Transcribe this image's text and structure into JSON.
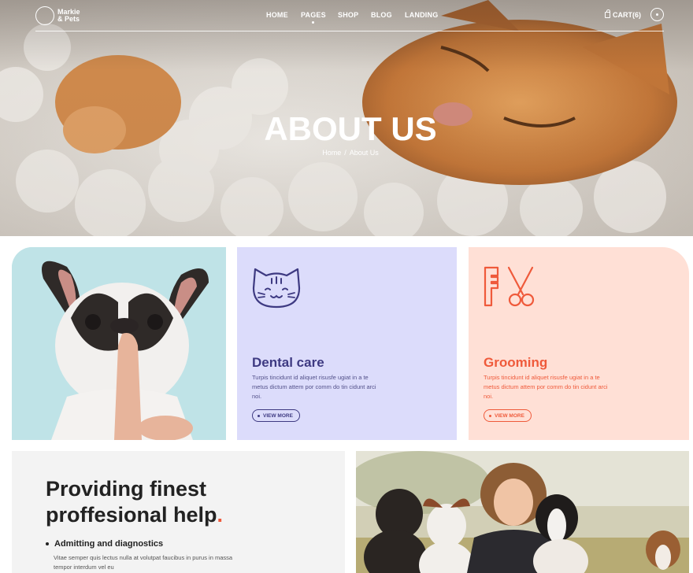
{
  "header": {
    "logo_line1": "Markie",
    "logo_line2": "& Pets",
    "nav": [
      "HOME",
      "PAGES",
      "SHOP",
      "BLOG",
      "LANDING"
    ],
    "active_nav": "PAGES",
    "cart_label": "CART(6)"
  },
  "hero": {
    "title": "ABOUT US",
    "breadcrumb_home": "Home",
    "breadcrumb_sep": "/",
    "breadcrumb_current": "About Us"
  },
  "cards": {
    "dental": {
      "title": "Dental care",
      "text": "Turpis tincidunt id aliquet risusfe ugiat in a te metus dictum attem por comm do tin cidunt arci noi.",
      "button": "VIEW MORE",
      "icon": "cat-icon",
      "color": "#3e3a82",
      "bg": "#dcdcfb"
    },
    "grooming": {
      "title": "Grooming",
      "text": "Turpis tincidunt id aliquet risusfe ugiat in a te metus dictum attem por comm do tin cidunt arci noi.",
      "button": "VIEW MORE",
      "icon": "comb-scissors-icon",
      "color": "#ef5a3b",
      "bg": "#ffe0d6"
    }
  },
  "info": {
    "heading_line1": "Providing finest",
    "heading_line2": "proffesional help",
    "heading_dot": ".",
    "bullet_title": "Admitting and diagnostics",
    "bullet_text": "Vitae semper quis lectus nulla at volutpat faucibus in purus in massa tempor interdum vel eu"
  }
}
